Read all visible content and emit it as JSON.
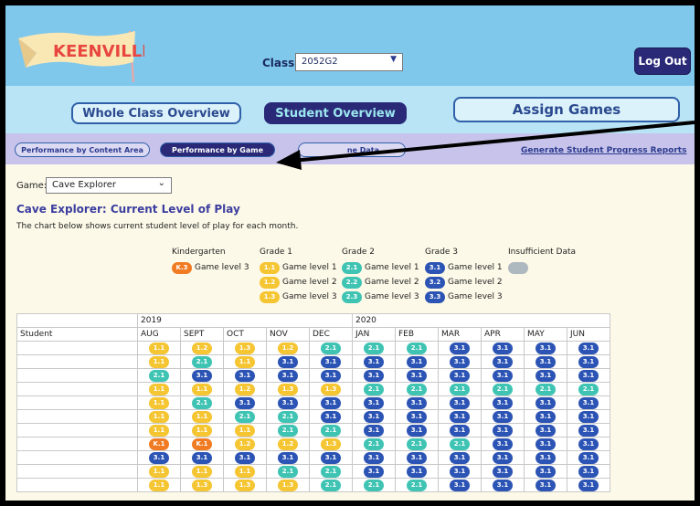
{
  "app": {
    "logo_text": "KEENVILLE"
  },
  "header": {
    "class_label": "Class:",
    "class_value": "2052G2",
    "logout_label": "Log Out"
  },
  "nav": {
    "whole_class": "Whole Class Overview",
    "student_overview": "Student Overview",
    "assign_games": "Assign Games"
  },
  "subnav": {
    "by_content": "Performance by Content Area",
    "by_game": "Performance by Game",
    "hidden_tab": "ne Data",
    "reports": "Generate Student Progress Reports"
  },
  "game_filter": {
    "label": "Game:",
    "value": "Cave Explorer"
  },
  "chart": {
    "title": "Cave Explorer: Current Level of Play",
    "description": "The chart below shows current student level of play for each month."
  },
  "legend": {
    "kindergarten": {
      "header": "Kindergarten",
      "items": [
        {
          "code": "K.3",
          "label": "Game level 3"
        }
      ]
    },
    "grade1": {
      "header": "Grade 1",
      "items": [
        {
          "code": "1.1",
          "label": "Game level 1"
        },
        {
          "code": "1.2",
          "label": "Game level 2"
        },
        {
          "code": "1.3",
          "label": "Game level 3"
        }
      ]
    },
    "grade2": {
      "header": "Grade 2",
      "items": [
        {
          "code": "2.1",
          "label": "Game level 1"
        },
        {
          "code": "2.2",
          "label": "Game level 2"
        },
        {
          "code": "2.3",
          "label": "Game level 3"
        }
      ]
    },
    "grade3": {
      "header": "Grade 3",
      "items": [
        {
          "code": "3.1",
          "label": "Game level 1"
        },
        {
          "code": "3.2",
          "label": "Game level 2"
        },
        {
          "code": "3.3",
          "label": "Game level 3"
        }
      ]
    },
    "insufficient": {
      "header": "Insufficient Data"
    }
  },
  "table": {
    "student_header": "Student",
    "year_2019": "2019",
    "year_2020": "2020",
    "months": [
      "AUG",
      "SEPT",
      "OCT",
      "NOV",
      "DEC",
      "JAN",
      "FEB",
      "MAR",
      "APR",
      "MAY",
      "JUN"
    ],
    "rows": [
      [
        "1.1",
        "1.2",
        "1.3",
        "1.2",
        "2.1",
        "2.1",
        "2.1",
        "3.1",
        "3.1",
        "3.1",
        "3.1"
      ],
      [
        "1.1",
        "2.1",
        "1.1",
        "3.1",
        "3.1",
        "3.1",
        "3.1",
        "3.1",
        "3.1",
        "3.1",
        "3.1"
      ],
      [
        "2.1",
        "3.1",
        "3.1",
        "3.1",
        "3.1",
        "3.1",
        "3.1",
        "3.1",
        "3.1",
        "3.1",
        "3.1"
      ],
      [
        "1.1",
        "1.1",
        "1.2",
        "1.3",
        "1.3",
        "2.1",
        "2.1",
        "2.1",
        "2.1",
        "2.1",
        "2.1"
      ],
      [
        "1.1",
        "2.1",
        "3.1",
        "3.1",
        "3.1",
        "3.1",
        "3.1",
        "3.1",
        "3.1",
        "3.1",
        "3.1"
      ],
      [
        "1.1",
        "1.1",
        "2.1",
        "2.1",
        "3.1",
        "3.1",
        "3.1",
        "3.1",
        "3.1",
        "3.1",
        "3.1"
      ],
      [
        "1.1",
        "1.1",
        "1.1",
        "2.1",
        "2.1",
        "3.1",
        "3.1",
        "3.1",
        "3.1",
        "3.1",
        "3.1"
      ],
      [
        "K.1",
        "K.1",
        "1.2",
        "1.2",
        "1.3",
        "2.1",
        "2.1",
        "2.1",
        "3.1",
        "3.1",
        "3.1"
      ],
      [
        "3.1",
        "3.1",
        "3.1",
        "3.1",
        "3.1",
        "3.1",
        "3.1",
        "3.1",
        "3.1",
        "3.1",
        "3.1"
      ],
      [
        "1.1",
        "1.1",
        "1.1",
        "2.1",
        "2.1",
        "3.1",
        "3.1",
        "3.1",
        "3.1",
        "3.1",
        "3.1"
      ],
      [
        "1.1",
        "1.3",
        "1.3",
        "1.3",
        "2.1",
        "2.1",
        "2.1",
        "3.1",
        "3.1",
        "3.1",
        "3.1"
      ]
    ]
  },
  "colors": {
    "kindergarten": "#f07b23",
    "grade1": "#f5c532",
    "grade2": "#3fc4b3",
    "grade3": "#2c54b5",
    "insufficient": "#aeb8bf",
    "nav_active": "#2a2978"
  }
}
